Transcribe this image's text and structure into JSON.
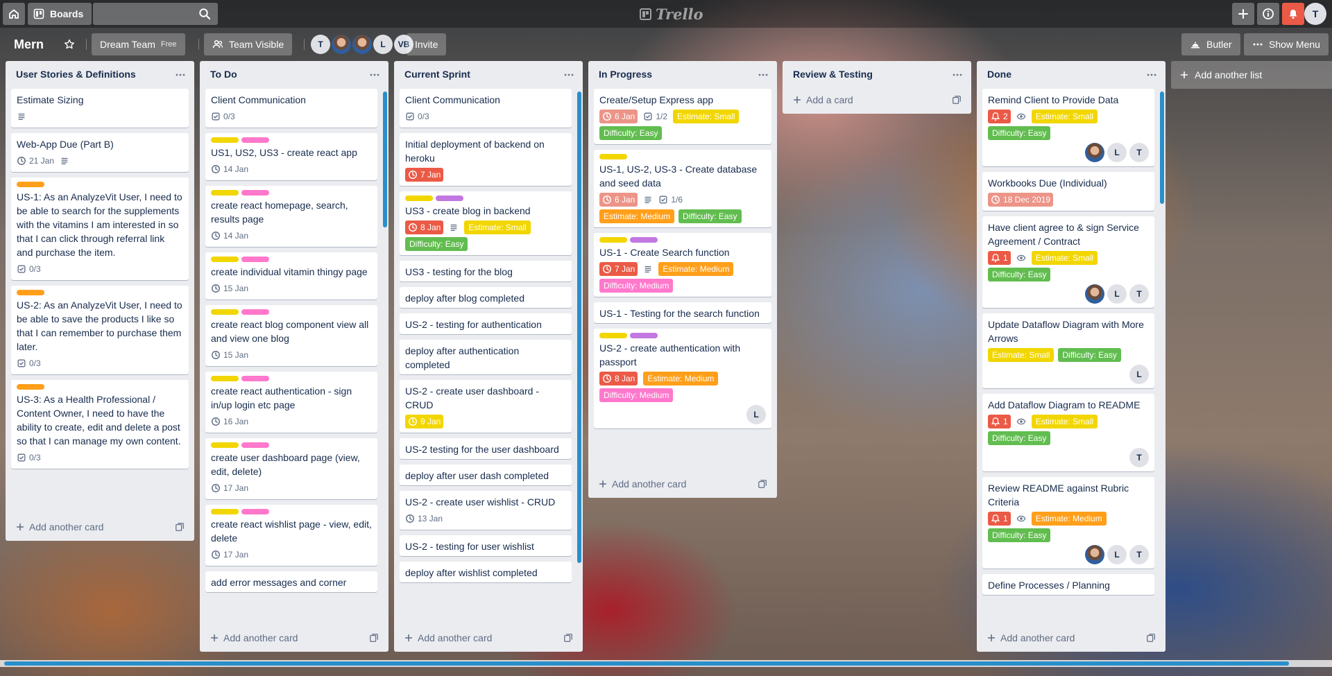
{
  "topbar": {
    "boards_label": "Boards",
    "search_value": "",
    "logo_text": "Trello",
    "user_initial": "T"
  },
  "board": {
    "title": "Mern",
    "team_label": "Dream Team",
    "team_plan": "Free",
    "visibility_label": "Team Visible",
    "members": [
      "T",
      "",
      "",
      "L",
      "VB"
    ],
    "invite_label": "Invite",
    "butler_label": "Butler",
    "menu_label": "Show Menu"
  },
  "colors": {
    "label_yellow": "#f2d600",
    "label_orange": "#ff9f1a",
    "label_green": "#61bd4f",
    "label_pink": "#ff78cb",
    "label_purple": "#c377e0",
    "date_overdue": "#eb5a46",
    "scroll_accent": "#298fca"
  },
  "lists": [
    {
      "title": "User Stories & Definitions",
      "add_card_label": "Add another card",
      "cards": [
        {
          "title": "Estimate Sizing"
        },
        {
          "title": "Web-App Due (Part B)",
          "date": "21 Jan"
        },
        {
          "title": "US-1: As an AnalyzeVit User, I need to be able to search for the supplements with the vitamins I am interested in so that I can click through referral link and purchase the item.",
          "checklist": "0/3"
        },
        {
          "title": "US-2: As an AnalyzeVit User, I need to be able to save the products I like so that I can remember to purchase them later.",
          "checklist": "0/3"
        },
        {
          "title": "US-3: As a Health Professional / Content Owner, I need to have the ability to create, edit and delete a post so that I can manage my own content.",
          "checklist": "0/3"
        }
      ]
    },
    {
      "title": "To Do",
      "add_card_label": "Add another card",
      "cards": [
        {
          "title": "Client Communication",
          "checklist": "0/3"
        },
        {
          "title": "US1, US2, US3 - create react app",
          "date": "14 Jan"
        },
        {
          "title": "create react homepage, search, results page",
          "date": "14 Jan"
        },
        {
          "title": "create individual vitamin thingy page",
          "date": "15 Jan"
        },
        {
          "title": "create react blog component view all and view one blog",
          "date": "15 Jan"
        },
        {
          "title": "create react authentication - sign in/up login etc page",
          "date": "16 Jan"
        },
        {
          "title": "create user dashboard page (view, edit, delete)",
          "date": "17 Jan"
        },
        {
          "title": "create react wishlist page - view, edit, delete",
          "date": "17 Jan"
        },
        {
          "title": "add error messages and corner"
        }
      ]
    },
    {
      "title": "Current Sprint",
      "add_card_label": "Add another card",
      "cards": [
        {
          "title": "Client Communication",
          "checklist": "0/3"
        },
        {
          "title": "Initial deployment of backend on heroku",
          "date": "7 Jan"
        },
        {
          "title": "US3 - create blog in backend",
          "date": "8 Jan",
          "tags": [
            "Estimate: Small",
            "Difficulty: Easy"
          ]
        },
        {
          "title": "US3 - testing for the blog"
        },
        {
          "title": "deploy after blog completed"
        },
        {
          "title": "US-2 - testing for authentication"
        },
        {
          "title": "deploy after authentication completed"
        },
        {
          "title": "US-2 - create user dashboard - CRUD",
          "date": "9 Jan"
        },
        {
          "title": "US-2 testing for the user dashboard"
        },
        {
          "title": "deploy after user dash completed"
        },
        {
          "title": "US-2 - create user wishlist - CRUD",
          "date": "13 Jan"
        },
        {
          "title": "US-2 - testing for user wishlist"
        },
        {
          "title": "deploy after wishlist completed"
        }
      ]
    },
    {
      "title": "In Progress",
      "add_card_label": "Add another card",
      "cards": [
        {
          "title": "Create/Setup Express app",
          "date": "6 Jan",
          "checklist": "1/2",
          "tags": [
            "Estimate: Small",
            "Difficulty: Easy"
          ]
        },
        {
          "title": "US-1, US-2, US-3 - Create database and seed data",
          "date": "6 Jan",
          "checklist": "1/6",
          "tags": [
            "Estimate: Medium",
            "Difficulty: Easy"
          ]
        },
        {
          "title": "US-1 - Create Search function",
          "date": "7 Jan",
          "tags": [
            "Estimate: Medium",
            "Difficulty: Medium"
          ]
        },
        {
          "title": "US-1 - Testing for the search function"
        },
        {
          "title": "US-2 - create authentication with passport",
          "date": "8 Jan",
          "tags": [
            "Estimate: Medium",
            "Difficulty: Medium"
          ],
          "members": [
            "L"
          ]
        }
      ]
    },
    {
      "title": "Review & Testing",
      "add_card_label": "Add a card",
      "cards": []
    },
    {
      "title": "Done",
      "add_card_label": "Add another card",
      "cards": [
        {
          "title": "Remind Client to Provide Data",
          "notifications": "2",
          "tags": [
            "Estimate: Small",
            "Difficulty: Easy"
          ],
          "members": [
            "",
            "L",
            "T"
          ]
        },
        {
          "title": "Workbooks Due (Individual)",
          "date": "18 Dec 2019"
        },
        {
          "title": "Have client agree to & sign Service Agreement / Contract",
          "notifications": "1",
          "tags": [
            "Estimate: Small",
            "Difficulty: Easy"
          ],
          "members": [
            "",
            "L",
            "T"
          ]
        },
        {
          "title": "Update Dataflow Diagram with More Arrows",
          "tags": [
            "Estimate: Small",
            "Difficulty: Easy"
          ],
          "members": [
            "L"
          ]
        },
        {
          "title": "Add Dataflow Diagram to README",
          "notifications": "1",
          "tags": [
            "Estimate: Small",
            "Difficulty: Easy"
          ],
          "members": [
            "T"
          ]
        },
        {
          "title": "Review README against Rubric Criteria",
          "notifications": "1",
          "tags": [
            "Estimate: Medium",
            "Difficulty: Easy"
          ],
          "members": [
            "",
            "L",
            "T"
          ]
        },
        {
          "title": "Define Processes / Planning"
        }
      ]
    }
  ],
  "add_list_label": "Add another list"
}
